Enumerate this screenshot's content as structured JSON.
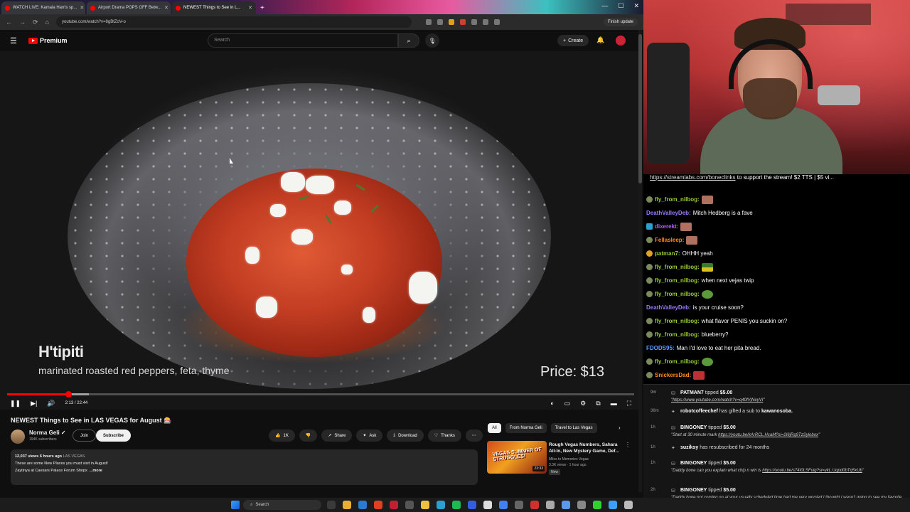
{
  "browser": {
    "tabs": [
      {
        "label": "WATCH LIVE: Kamala Harris sp..."
      },
      {
        "label": "Airport Drama POPS OFF Betw..."
      },
      {
        "label": "NEWEST Things to See in L..."
      }
    ],
    "url": "youtube.com/watch?v=8gBtZoV-o",
    "finish_update": "Finish update",
    "window_controls": [
      "—",
      "☐",
      "✕"
    ]
  },
  "youtube": {
    "logo_text": "Premium",
    "search_placeholder": "Search",
    "create_label": "Create",
    "video": {
      "overlay_title": "H'tipiti",
      "overlay_subtitle": "marinated roasted red peppers, feta, thyme",
      "overlay_price": "Price: $13",
      "time": "2:13 / 22:44",
      "progress": 0.098,
      "buffered": 0.13
    },
    "title": "NEWEST Things to See in LAS VEGAS for August 🎰",
    "channel": {
      "name": "Norma Geli ✓",
      "subs": "194K subscribers"
    },
    "join_label": "Join",
    "subscribe_label": "Subscribe",
    "actions": [
      {
        "icon": "thumbs-up-icon",
        "glyph": "👍",
        "label": "1K"
      },
      {
        "icon": "thumbs-down-icon",
        "glyph": "👎",
        "label": ""
      },
      {
        "icon": "share-icon",
        "glyph": "↗",
        "label": "Share"
      },
      {
        "icon": "ask-icon",
        "glyph": "✦",
        "label": "Ask"
      },
      {
        "icon": "download-icon",
        "glyph": "⤓",
        "label": "Download"
      },
      {
        "icon": "thanks-icon",
        "glyph": "♡",
        "label": "Thanks"
      },
      {
        "icon": "more-icon",
        "glyph": "⋯",
        "label": ""
      }
    ],
    "description": {
      "meta": "12,037 views  6 hours ago",
      "tag": "LAS VEGAS",
      "line1": "These are some New Places you must visit in August!",
      "line2": "Zaytinya at Caesars Palace Forum Shops",
      "more": "...more"
    },
    "chips": [
      "All",
      "From Norma Geli",
      "Travel to Las Vegas"
    ],
    "related": {
      "thumb_text": "VEGAS SUMMER OF STRUGGLES!",
      "duration": "23:33",
      "title": "Rough Vegas Numbers, Sahara All-In, New Mystery Game, Def...",
      "channel": "Miles to Memories Vegas",
      "meta": "3.3K views · 1 hour ago",
      "badge": "New"
    }
  },
  "stream": {
    "banner_link": "https://streamlabs.com/boneclinks",
    "banner_text": " to support the stream! $2 TTS | $5 vi..."
  },
  "chat": [
    {
      "user": "fly_from_nilbog:",
      "text": "",
      "color": "#9acd32",
      "badge": "b",
      "emote": "emote"
    },
    {
      "user": "DeathValleyDeb:",
      "text": "Mitch Hedberg is a fave",
      "color": "#9a7aff",
      "badge": "",
      "emote": ""
    },
    {
      "user": "dixerekt:",
      "text": "",
      "color": "#b062ff",
      "badge": "b2",
      "emote": "emote"
    },
    {
      "user": "Fellasleep:",
      "text": "",
      "color": "#ff8c1a",
      "badge": "b",
      "emote": "emote"
    },
    {
      "user": "patman7:",
      "text": "OHHH yeah",
      "color": "#9acd32",
      "badge": "b3",
      "emote": ""
    },
    {
      "user": "fly_from_nilbog:",
      "text": "",
      "color": "#9acd32",
      "badge": "b",
      "emote": "emote flag"
    },
    {
      "user": "fly_from_nilbog:",
      "text": "when next vejas twip",
      "color": "#9acd32",
      "badge": "b",
      "emote": ""
    },
    {
      "user": "fly_from_nilbog:",
      "text": "",
      "color": "#9acd32",
      "badge": "b",
      "emote": "emote green"
    },
    {
      "user": "DeathValleyDeb:",
      "text": "is your cruise soon?",
      "color": "#9a7aff",
      "badge": "",
      "emote": ""
    },
    {
      "user": "fly_from_nilbog:",
      "text": "what flavor PENIS you suckin on?",
      "color": "#9acd32",
      "badge": "b",
      "emote": ""
    },
    {
      "user": "fly_from_nilbog:",
      "text": "blueberry?",
      "color": "#9acd32",
      "badge": "b",
      "emote": ""
    },
    {
      "user": "FDODS95:",
      "text": "Man I'd love to eat her pita bread.",
      "color": "#5aa0ff",
      "badge": "",
      "emote": ""
    },
    {
      "user": "fly_from_nilbog:",
      "text": "",
      "color": "#9acd32",
      "badge": "b",
      "emote": "emote green"
    },
    {
      "user": "SnickersDad:",
      "text": "",
      "color": "#ff8c1a",
      "badge": "b",
      "emote": "emote red"
    }
  ],
  "events": [
    {
      "age": "9m",
      "icon": "⛁",
      "who": "PATMAN7",
      "rest": " tipped ",
      "amount": "$5.00",
      "link": "https://www.youtube.com/watch?v=q40fVjNeyVI",
      "pre": "",
      "post": ""
    },
    {
      "age": "36m",
      "icon": "✦",
      "who": "robotcoffeechef",
      "rest": " has gifted a sub to ",
      "amount": "kawanosoba.",
      "link": "",
      "pre": "",
      "post": ""
    },
    {
      "age": "1h",
      "icon": "⛁",
      "who": "BINGONEY",
      "rest": " tipped ",
      "amount": "$5.00",
      "link": "https://youtu.be/kArRCL.HcaM?si=2I6jRg9TzSylobox",
      "pre": "\"Start at 30 minute mark ",
      "post": "\""
    },
    {
      "age": "1h",
      "icon": "✦",
      "who": "suziksy",
      "rest": " has resubscribed for 24 months",
      "amount": "",
      "link": "",
      "pre": "",
      "post": ""
    },
    {
      "age": "1h",
      "icon": "⛁",
      "who": "BINGONEY",
      "rest": " tipped ",
      "amount": "$5.00",
      "link": "https://youtu.be/s74I0LSFuig?si=ykL.Uqpd0bTq5xUb",
      "pre": "\"Daddy bone can you explain what chip n win is ",
      "post": "\""
    },
    {
      "age": "2h",
      "icon": "⛁",
      "who": "BINGONEY",
      "rest": " tipped ",
      "amount": "$5.00",
      "link": "",
      "pre": "\"Daddy bone not coming on at your usually scheduled time had me very worried I thought I wasn't going to see my favorite streamer today but when the notification came out it was a signal from the heavens",
      "post": ""
    }
  ],
  "taskbar": {
    "search": "Search",
    "icon_colors": [
      "#3a3a3a",
      "#e8b030",
      "#2a7ad0",
      "#e04020",
      "#c02030",
      "#555",
      "#f0c040",
      "#2aa0d0",
      "#1db954",
      "#3060e0",
      "#ddd",
      "#4080f0",
      "#666",
      "#d03030",
      "#aaa",
      "#5a9aee",
      "#888",
      "#30d030",
      "#3aa0ff",
      "#bbb"
    ]
  }
}
